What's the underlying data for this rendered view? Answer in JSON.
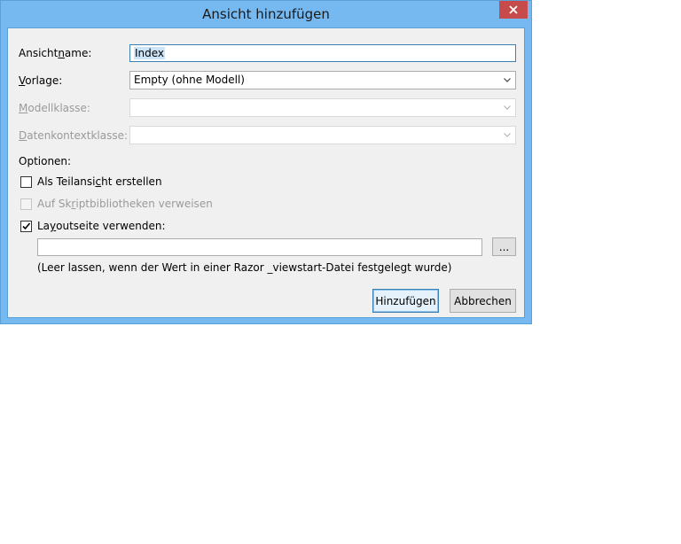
{
  "window": {
    "title": "Ansicht hinzufügen"
  },
  "form": {
    "view_name": {
      "label_pre": "Ansicht",
      "label_accel": "n",
      "label_post": "ame:",
      "value": "Index"
    },
    "template": {
      "label_pre": "",
      "label_accel": "V",
      "label_post": "orlage:",
      "value": "Empty (ohne Modell)"
    },
    "model_class": {
      "label_pre": "",
      "label_accel": "M",
      "label_post": "odellklasse:",
      "value": ""
    },
    "data_context_class": {
      "label_pre": "",
      "label_accel": "D",
      "label_post": "atenkontextklasse:",
      "value": ""
    },
    "options_label": "Optionen:",
    "partial_view": {
      "label_pre": "Als Teilansi",
      "label_accel": "c",
      "label_post": "ht erstellen",
      "checked": false
    },
    "script_libraries": {
      "label_pre": "Auf Sk",
      "label_accel": "r",
      "label_post": "iptbibliotheken verweisen",
      "checked": false,
      "enabled": false
    },
    "use_layout": {
      "label_pre": "La",
      "label_accel": "y",
      "label_post": "outseite verwenden:",
      "checked": true
    },
    "layout_path": {
      "value": ""
    },
    "browse_label": "...",
    "hint": "(Leer lassen, wenn der Wert in einer Razor _viewstart-Datei festgelegt wurde)"
  },
  "buttons": {
    "add_label": "Hinzufügen",
    "cancel_label": "Abbrechen"
  },
  "colors": {
    "frame": "#75b9f0",
    "close_button": "#c74b4b",
    "client_background": "#f0f0f0",
    "selection": "#cce4f7"
  }
}
